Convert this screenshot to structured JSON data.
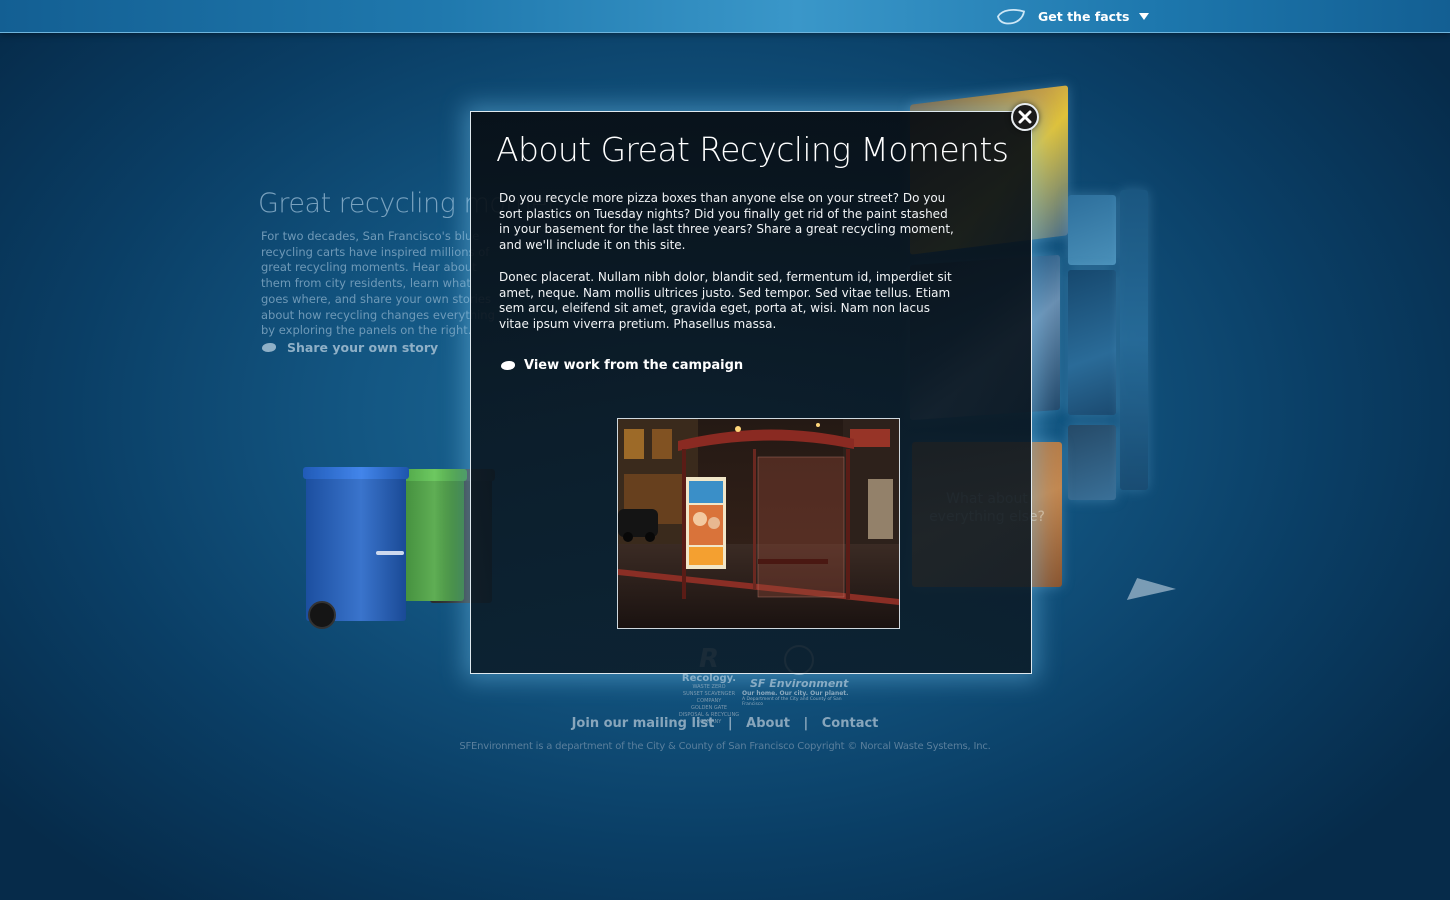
{
  "topbar": {
    "facts_label": "Get the facts"
  },
  "intro": {
    "title": "Great recycling moments",
    "body": "For two decades, San Francisco's blue recycling carts have inspired millions of great recycling moments. Hear about them from city residents, learn what goes where, and share your own stories about how recycling changes everything by exploring the panels on the right.",
    "share_label": "Share your own story"
  },
  "panels": {
    "question": "What about everything else?"
  },
  "modal": {
    "title": "About Great Recycling Moments",
    "paragraph_1": "Do you recycle more pizza boxes than anyone else on your street? Do you sort plastics on Tuesday nights? Did you finally get rid of the paint stashed in your basement for the last three years?  Share a great recycling moment, and we'll include it on this site.",
    "paragraph_2": "Donec placerat. Nullam nibh dolor, blandit sed, fermentum id, imperdiet sit amet, neque. Nam mollis ultrices justo. Sed tempor. Sed vitae tellus. Etiam sem arcu, eleifend sit amet, gravida eget, porta at, wisi. Nam non lacus vitae ipsum viverra pretium. Phasellus massa.",
    "view_work_label": "View work from the campaign"
  },
  "logos": {
    "recology_name": "Recology.",
    "recology_tag": "WASTE ZERO",
    "recology_sub_1": "SUNSET SCAVENGER COMPANY",
    "recology_sub_2": "GOLDEN GATE DISPOSAL & RECYCLING COMPANY",
    "sfe_name": "SF Environment",
    "sfe_tag": "Our home. Our city. Our planet.",
    "sfe_sub": "A Department of the City and County of San Francisco"
  },
  "footer": {
    "links": [
      "Join our mailing list",
      "About",
      "Contact"
    ],
    "separator": "|",
    "copyright": "SFEnvironment is a department of the City & County of San Francisco Copyright © Norcal Waste Systems, Inc."
  },
  "colors": {
    "accent": "#ffffff",
    "background": "#135682",
    "topbar": "#2a86bb"
  },
  "icons": {
    "facts": "leaf-outline-icon",
    "dropdown": "caret-down-icon",
    "close": "close-icon",
    "bullet": "leaf-bullet-icon"
  }
}
